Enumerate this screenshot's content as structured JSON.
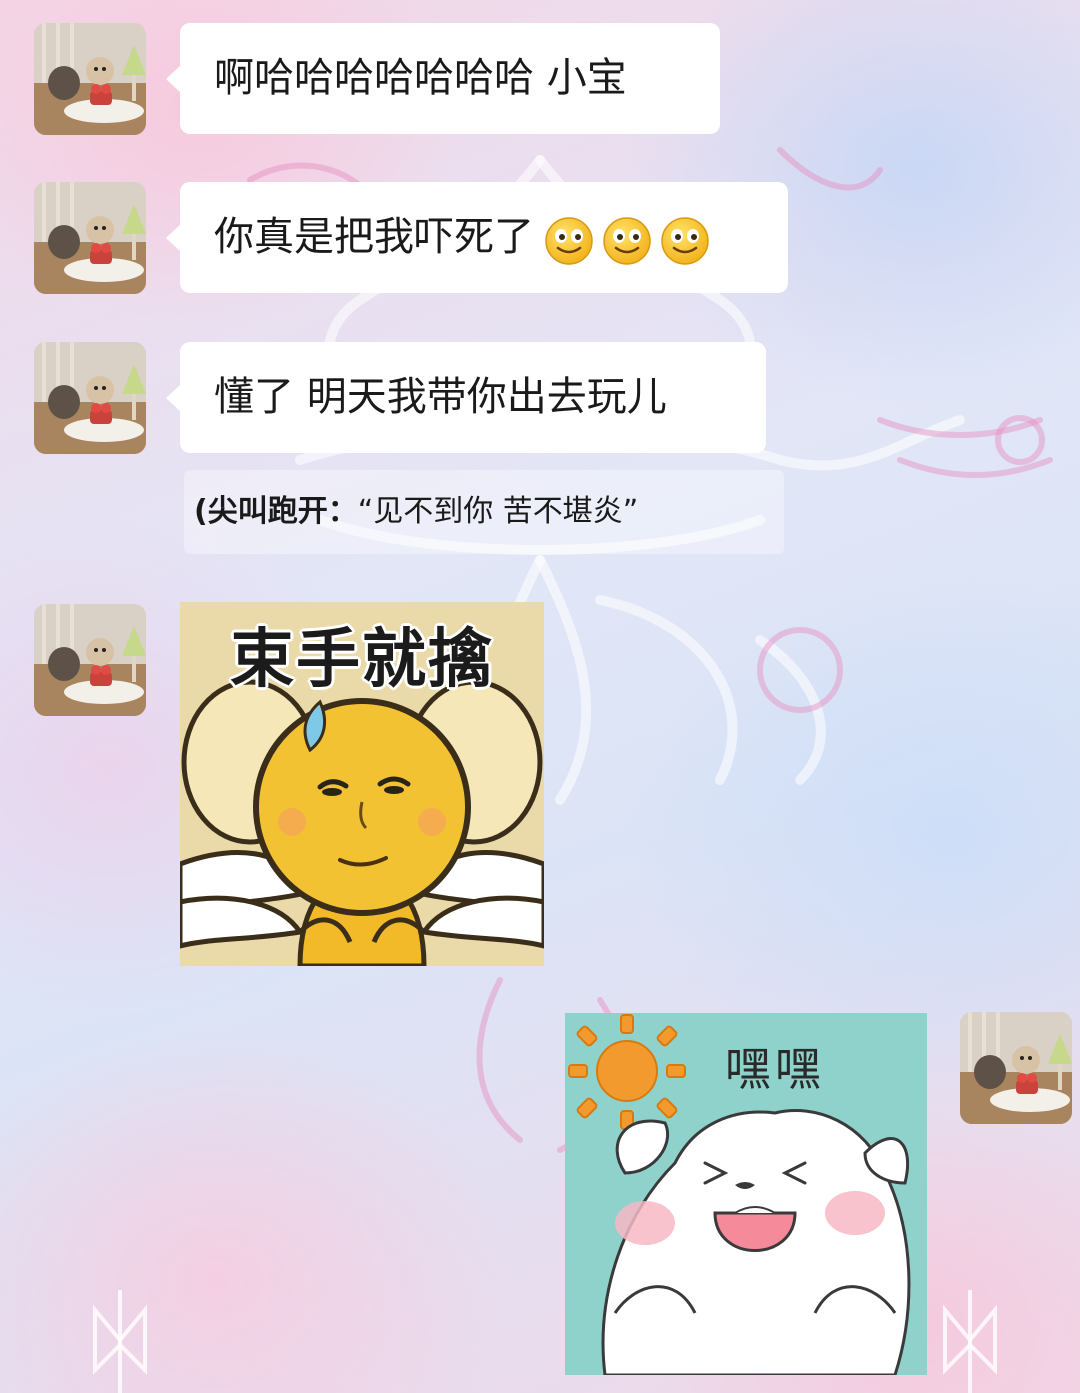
{
  "messages": [
    {
      "sender": "other",
      "text": "啊哈哈哈哈哈哈哈 小宝"
    },
    {
      "sender": "other",
      "text": "你真是把我吓死了",
      "emojis": [
        "smiling-face-emoji",
        "smiling-face-emoji",
        "smiling-face-emoji"
      ]
    },
    {
      "sender": "other",
      "text": "懂了 明天我带你出去玩儿"
    }
  ],
  "caption": {
    "bold": "(尖叫跑开：",
    "normal": "“见不到你 苦不堪炎”"
  },
  "stickers": [
    {
      "sender": "other",
      "text": "束手就擒",
      "icon": "angel-emoji-sticker"
    },
    {
      "sender": "me",
      "text": "嘿嘿",
      "icon": "happy-bear-sun-sticker"
    }
  ],
  "colors": {
    "bubble": "#ffffff",
    "sticker_yellow": "#f3c233",
    "sticker_teal": "#8fd2cc",
    "sun_orange": "#f29a2e"
  }
}
